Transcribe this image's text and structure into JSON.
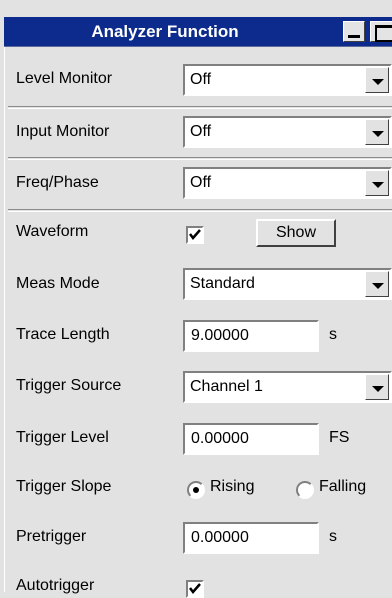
{
  "window": {
    "title": "Analyzer Function"
  },
  "level_monitor": {
    "label": "Level Monitor",
    "value": "Off"
  },
  "input_monitor": {
    "label": "Input Monitor",
    "value": "Off"
  },
  "freq_phase": {
    "label": "Freq/Phase",
    "value": "Off"
  },
  "waveform": {
    "label": "Waveform",
    "checked": true,
    "show_label": "Show"
  },
  "meas_mode": {
    "label": "Meas Mode",
    "value": "Standard"
  },
  "trace_length": {
    "label": "Trace Length",
    "value": "9.00000",
    "unit": "s"
  },
  "trigger_source": {
    "label": "Trigger Source",
    "value": "Channel 1"
  },
  "trigger_level": {
    "label": "Trigger Level",
    "value": "0.00000",
    "unit": "FS"
  },
  "trigger_slope": {
    "label": "Trigger Slope",
    "options": [
      "Rising",
      "Falling"
    ],
    "selected": "Rising"
  },
  "pretrigger": {
    "label": "Pretrigger",
    "value": "0.00000",
    "unit": "s"
  },
  "autotrigger": {
    "label": "Autotrigger",
    "checked": true
  },
  "colors": {
    "titlebar": "#0c2b8c",
    "panel": "#e2e2e2"
  }
}
